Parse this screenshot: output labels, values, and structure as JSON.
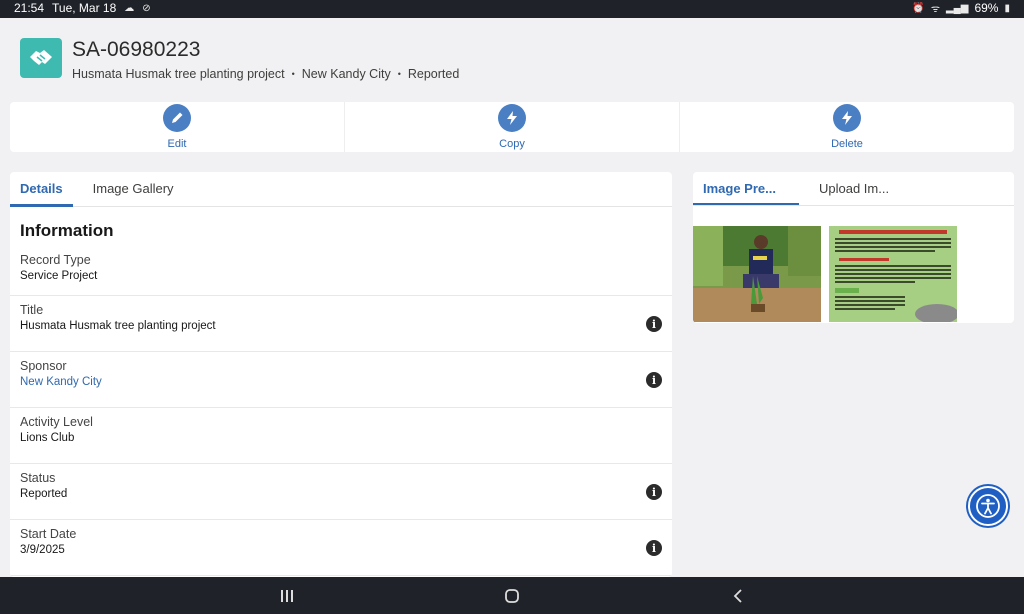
{
  "status_bar": {
    "time": "21:54",
    "date": "Tue, Mar 18",
    "battery": "69%"
  },
  "record": {
    "title": "SA-06980223",
    "subtitle_parts": [
      "Husmata Husmak tree planting project",
      "New Kandy City",
      "Reported"
    ],
    "icon": "handshake-icon",
    "icon_color": "#3ebab1"
  },
  "actions": [
    {
      "label": "Edit",
      "icon": "pencil-icon"
    },
    {
      "label": "Copy",
      "icon": "lightning-icon"
    },
    {
      "label": "Delete",
      "icon": "lightning-icon"
    }
  ],
  "left_tabs": [
    {
      "label": "Details",
      "active": true
    },
    {
      "label": "Image Gallery",
      "active": false
    }
  ],
  "section_heading": "Information",
  "fields": [
    {
      "label": "Record Type",
      "value": "Service Project",
      "link": false,
      "info": false
    },
    {
      "label": "Title",
      "value": "Husmata Husmak tree planting project",
      "link": false,
      "info": true
    },
    {
      "label": "Sponsor",
      "value": "New Kandy City",
      "link": true,
      "info": true
    },
    {
      "label": "Activity Level",
      "value": "Lions Club",
      "link": false,
      "info": false
    },
    {
      "label": "Status",
      "value": "Reported",
      "link": false,
      "info": true
    },
    {
      "label": "Start Date",
      "value": "3/9/2025",
      "link": false,
      "info": true
    }
  ],
  "right_tabs": [
    {
      "label": "Image Pre...",
      "active": true
    },
    {
      "label": "Upload Im...",
      "active": false
    }
  ],
  "colors": {
    "accent": "#2f69b1",
    "action_circle": "#4a7fc4",
    "accessibility": "#1f5fc4"
  }
}
